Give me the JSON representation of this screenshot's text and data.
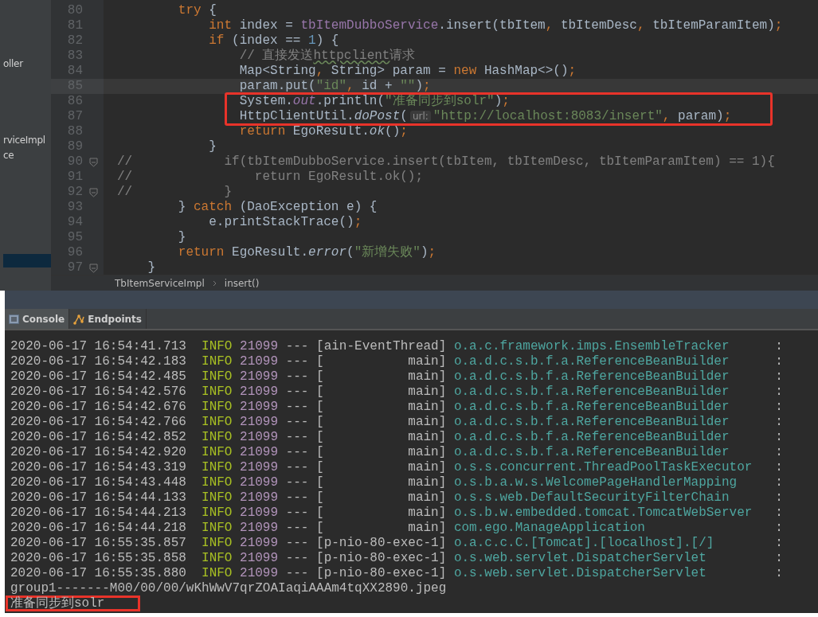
{
  "sidebar": {
    "items": [
      {
        "label": "oller",
        "selected": false
      },
      {
        "label": "rviceImpl",
        "selected": false
      },
      {
        "label": "ce",
        "selected": false
      },
      {
        "selected": true
      }
    ]
  },
  "editor": {
    "lines": [
      {
        "number": "80",
        "current": false,
        "highlighted": false,
        "fold": false,
        "tokens": [
          {
            "kind": "kw",
            "t": "        try"
          },
          {
            "kind": "plain",
            "t": " {"
          }
        ]
      },
      {
        "number": "81",
        "current": false,
        "highlighted": false,
        "fold": false,
        "tokens": [
          {
            "kind": "kw",
            "t": "            int"
          },
          {
            "kind": "plain",
            "t": " index = "
          },
          {
            "kind": "field",
            "t": "tbItemDubboService"
          },
          {
            "kind": "plain",
            "t": ".insert(tbItem"
          },
          {
            "kind": "punct",
            "t": ","
          },
          {
            "kind": "plain",
            "t": " tbItemDesc"
          },
          {
            "kind": "punct",
            "t": ","
          },
          {
            "kind": "plain",
            "t": " tbItemParamItem)"
          },
          {
            "kind": "punct",
            "t": ";"
          }
        ]
      },
      {
        "number": "82",
        "current": false,
        "highlighted": false,
        "fold": false,
        "tokens": [
          {
            "kind": "kw",
            "t": "            if"
          },
          {
            "kind": "plain",
            "t": " (index == "
          },
          {
            "kind": "num",
            "t": "1"
          },
          {
            "kind": "plain",
            "t": ") {"
          }
        ]
      },
      {
        "number": "83",
        "current": false,
        "highlighted": false,
        "fold": false,
        "tokens": [
          {
            "kind": "comment",
            "t": "                // 直接发送"
          },
          {
            "kind": "typo",
            "t": "httpclient"
          },
          {
            "kind": "comment",
            "t": "请求"
          }
        ]
      },
      {
        "number": "84",
        "current": false,
        "highlighted": false,
        "fold": false,
        "tokens": [
          {
            "kind": "plain",
            "t": "                Map<String"
          },
          {
            "kind": "punct",
            "t": ","
          },
          {
            "kind": "plain",
            "t": " String> param = "
          },
          {
            "kind": "kw",
            "t": "new"
          },
          {
            "kind": "plain",
            "t": " HashMap<>()"
          },
          {
            "kind": "punct",
            "t": ";"
          }
        ]
      },
      {
        "number": "85",
        "current": true,
        "highlighted": false,
        "fold": false,
        "tokens": [
          {
            "kind": "plain",
            "t": "                param.put("
          },
          {
            "kind": "str",
            "t": "\"id\""
          },
          {
            "kind": "punct",
            "t": ","
          },
          {
            "kind": "plain",
            "t": " id + "
          },
          {
            "kind": "str",
            "t": "\"\""
          },
          {
            "kind": "plain",
            "t": ")"
          },
          {
            "kind": "punct",
            "t": ";"
          }
        ]
      },
      {
        "number": "86",
        "current": false,
        "highlighted": true,
        "fold": false,
        "tokens": [
          {
            "kind": "plain",
            "t": "                System."
          },
          {
            "kind": "fielditalic",
            "t": "out"
          },
          {
            "kind": "plain",
            "t": ".println("
          },
          {
            "kind": "str",
            "t": "\"准备同步到solr\""
          },
          {
            "kind": "plain",
            "t": ")"
          },
          {
            "kind": "punct",
            "t": ";"
          }
        ]
      },
      {
        "number": "87",
        "current": false,
        "highlighted": true,
        "fold": false,
        "tokens": [
          {
            "kind": "plain",
            "t": "                HttpClientUtil."
          },
          {
            "kind": "italic",
            "t": "doPost"
          },
          {
            "kind": "plain",
            "t": "("
          },
          {
            "kind": "hint",
            "t": "url:"
          },
          {
            "kind": "str",
            "t": "\"http://localhost:8083/insert\""
          },
          {
            "kind": "punct",
            "t": ","
          },
          {
            "kind": "plain",
            "t": " param)"
          },
          {
            "kind": "punct",
            "t": ";"
          }
        ]
      },
      {
        "number": "88",
        "current": false,
        "highlighted": false,
        "fold": false,
        "tokens": [
          {
            "kind": "kw",
            "t": "                return"
          },
          {
            "kind": "plain",
            "t": " EgoResult."
          },
          {
            "kind": "italic",
            "t": "ok"
          },
          {
            "kind": "plain",
            "t": "()"
          },
          {
            "kind": "punct",
            "t": ";"
          }
        ]
      },
      {
        "number": "89",
        "current": false,
        "highlighted": false,
        "fold": false,
        "tokens": [
          {
            "kind": "plain",
            "t": "            }"
          }
        ]
      },
      {
        "number": "90",
        "current": false,
        "highlighted": false,
        "fold": true,
        "tokens": [
          {
            "kind": "comment",
            "t": "//            if(tbItemDubboService.insert(tbItem, tbItemDesc, tbItemParamItem) == 1){"
          }
        ]
      },
      {
        "number": "91",
        "current": false,
        "highlighted": false,
        "fold": false,
        "tokens": [
          {
            "kind": "comment",
            "t": "//                return EgoResult.ok();"
          }
        ]
      },
      {
        "number": "92",
        "current": false,
        "highlighted": false,
        "fold": true,
        "tokens": [
          {
            "kind": "comment",
            "t": "//            }"
          }
        ]
      },
      {
        "number": "93",
        "current": false,
        "highlighted": false,
        "fold": false,
        "tokens": [
          {
            "kind": "plain",
            "t": "        } "
          },
          {
            "kind": "kw",
            "t": "catch"
          },
          {
            "kind": "plain",
            "t": " (DaoException e) {"
          }
        ]
      },
      {
        "number": "94",
        "current": false,
        "highlighted": false,
        "fold": false,
        "tokens": [
          {
            "kind": "plain",
            "t": "            e.printStackTrace()"
          },
          {
            "kind": "punct",
            "t": ";"
          }
        ]
      },
      {
        "number": "95",
        "current": false,
        "highlighted": false,
        "fold": false,
        "tokens": [
          {
            "kind": "plain",
            "t": "        }"
          }
        ]
      },
      {
        "number": "96",
        "current": false,
        "highlighted": false,
        "fold": false,
        "tokens": [
          {
            "kind": "kw",
            "t": "        return"
          },
          {
            "kind": "plain",
            "t": " EgoResult."
          },
          {
            "kind": "italic",
            "t": "error"
          },
          {
            "kind": "plain",
            "t": "("
          },
          {
            "kind": "str",
            "t": "\"新增失败\""
          },
          {
            "kind": "plain",
            "t": ")"
          },
          {
            "kind": "punct",
            "t": ";"
          }
        ]
      },
      {
        "number": "97",
        "current": false,
        "highlighted": false,
        "fold": true,
        "tokens": [
          {
            "kind": "plain",
            "t": "    }"
          }
        ]
      }
    ]
  },
  "breadcrumb": [
    "TbItemServiceImpl",
    "insert()"
  ],
  "tabs": [
    {
      "label": "Console",
      "kind": "console",
      "selected": true
    },
    {
      "label": "Endpoints",
      "kind": "endpoints",
      "selected": false
    }
  ],
  "console": {
    "lines": [
      {
        "kind": "log",
        "highlighted": false,
        "time": "2020-06-17 16:54:41.713",
        "level": "INFO",
        "pid": "21099",
        "sep": "---",
        "thread": "[ain-EventThread]",
        "logger": "o.a.c.framework.imps.EnsembleTracker",
        "colon": ":"
      },
      {
        "kind": "log",
        "highlighted": false,
        "time": "2020-06-17 16:54:42.183",
        "level": "INFO",
        "pid": "21099",
        "sep": "---",
        "thread": "[           main]",
        "logger": "o.a.d.c.s.b.f.a.ReferenceBeanBuilder",
        "colon": ":"
      },
      {
        "kind": "log",
        "highlighted": false,
        "time": "2020-06-17 16:54:42.485",
        "level": "INFO",
        "pid": "21099",
        "sep": "---",
        "thread": "[           main]",
        "logger": "o.a.d.c.s.b.f.a.ReferenceBeanBuilder",
        "colon": ":"
      },
      {
        "kind": "log",
        "highlighted": false,
        "time": "2020-06-17 16:54:42.576",
        "level": "INFO",
        "pid": "21099",
        "sep": "---",
        "thread": "[           main]",
        "logger": "o.a.d.c.s.b.f.a.ReferenceBeanBuilder",
        "colon": ":"
      },
      {
        "kind": "log",
        "highlighted": false,
        "time": "2020-06-17 16:54:42.676",
        "level": "INFO",
        "pid": "21099",
        "sep": "---",
        "thread": "[           main]",
        "logger": "o.a.d.c.s.b.f.a.ReferenceBeanBuilder",
        "colon": ":"
      },
      {
        "kind": "log",
        "highlighted": false,
        "time": "2020-06-17 16:54:42.766",
        "level": "INFO",
        "pid": "21099",
        "sep": "---",
        "thread": "[           main]",
        "logger": "o.a.d.c.s.b.f.a.ReferenceBeanBuilder",
        "colon": ":"
      },
      {
        "kind": "log",
        "highlighted": false,
        "time": "2020-06-17 16:54:42.852",
        "level": "INFO",
        "pid": "21099",
        "sep": "---",
        "thread": "[           main]",
        "logger": "o.a.d.c.s.b.f.a.ReferenceBeanBuilder",
        "colon": ":"
      },
      {
        "kind": "log",
        "highlighted": false,
        "time": "2020-06-17 16:54:42.920",
        "level": "INFO",
        "pid": "21099",
        "sep": "---",
        "thread": "[           main]",
        "logger": "o.a.d.c.s.b.f.a.ReferenceBeanBuilder",
        "colon": ":"
      },
      {
        "kind": "log",
        "highlighted": false,
        "time": "2020-06-17 16:54:43.319",
        "level": "INFO",
        "pid": "21099",
        "sep": "---",
        "thread": "[           main]",
        "logger": "o.s.s.concurrent.ThreadPoolTaskExecutor",
        "colon": ":"
      },
      {
        "kind": "log",
        "highlighted": false,
        "time": "2020-06-17 16:54:43.448",
        "level": "INFO",
        "pid": "21099",
        "sep": "---",
        "thread": "[           main]",
        "logger": "o.s.b.a.w.s.WelcomePageHandlerMapping",
        "colon": ":"
      },
      {
        "kind": "log",
        "highlighted": false,
        "time": "2020-06-17 16:54:44.133",
        "level": "INFO",
        "pid": "21099",
        "sep": "---",
        "thread": "[           main]",
        "logger": "o.s.s.web.DefaultSecurityFilterChain",
        "colon": ":"
      },
      {
        "kind": "log",
        "highlighted": false,
        "time": "2020-06-17 16:54:44.213",
        "level": "INFO",
        "pid": "21099",
        "sep": "---",
        "thread": "[           main]",
        "logger": "o.s.b.w.embedded.tomcat.TomcatWebServer",
        "colon": ":"
      },
      {
        "kind": "log",
        "highlighted": false,
        "time": "2020-06-17 16:54:44.218",
        "level": "INFO",
        "pid": "21099",
        "sep": "---",
        "thread": "[           main]",
        "logger": "com.ego.ManageApplication",
        "colon": ":"
      },
      {
        "kind": "log",
        "highlighted": false,
        "time": "2020-06-17 16:55:35.857",
        "level": "INFO",
        "pid": "21099",
        "sep": "---",
        "thread": "[p-nio-80-exec-1]",
        "logger": "o.a.c.c.C.[Tomcat].[localhost].[/]",
        "colon": ":"
      },
      {
        "kind": "log",
        "highlighted": false,
        "time": "2020-06-17 16:55:35.858",
        "level": "INFO",
        "pid": "21099",
        "sep": "---",
        "thread": "[p-nio-80-exec-1]",
        "logger": "o.s.web.servlet.DispatcherServlet",
        "colon": ":"
      },
      {
        "kind": "log",
        "highlighted": false,
        "time": "2020-06-17 16:55:35.880",
        "level": "INFO",
        "pid": "21099",
        "sep": "---",
        "thread": "[p-nio-80-exec-1]",
        "logger": "o.s.web.servlet.DispatcherServlet",
        "colon": ":"
      },
      {
        "kind": "text",
        "highlighted": false,
        "text": "group1-------M00/00/00/wKhWwV7qrZOAIaqiAAAm4tqXX2890.jpeg"
      },
      {
        "kind": "text",
        "highlighted": true,
        "text": "准备同步到solr"
      }
    ]
  }
}
